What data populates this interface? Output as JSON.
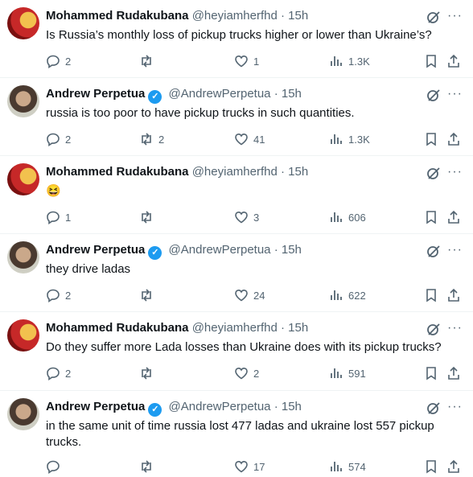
{
  "tweets": [
    {
      "author": "Mohammed Rudakubana",
      "handle": "@heyiamherfhd",
      "dot": "·",
      "time": "15h",
      "verified": false,
      "text": "Is Russia’s monthly loss of pickup trucks higher or lower than Ukraine’s?",
      "replies": "2",
      "retweets": "",
      "likes": "1",
      "views": "1.3K"
    },
    {
      "author": "Andrew Perpetua",
      "handle": "@AndrewPerpetua",
      "dot": "·",
      "time": "15h",
      "verified": true,
      "text": "russia is too poor to have pickup trucks in such quantities.",
      "replies": "2",
      "retweets": "2",
      "likes": "41",
      "views": "1.3K"
    },
    {
      "author": "Mohammed Rudakubana",
      "handle": "@heyiamherfhd",
      "dot": "·",
      "time": "15h",
      "verified": false,
      "text": "😆",
      "replies": "1",
      "retweets": "",
      "likes": "3",
      "views": "606"
    },
    {
      "author": "Andrew Perpetua",
      "handle": "@AndrewPerpetua",
      "dot": "·",
      "time": "15h",
      "verified": true,
      "text": "they drive ladas",
      "replies": "2",
      "retweets": "",
      "likes": "24",
      "views": "622"
    },
    {
      "author": "Mohammed Rudakubana",
      "handle": "@heyiamherfhd",
      "dot": "·",
      "time": "15h",
      "verified": false,
      "text": "Do they suffer more Lada losses than Ukraine does with its pickup trucks?",
      "replies": "2",
      "retweets": "",
      "likes": "2",
      "views": "591"
    },
    {
      "author": "Andrew Perpetua",
      "handle": "@AndrewPerpetua",
      "dot": "·",
      "time": "15h",
      "verified": true,
      "text": "in the same unit of time russia lost 477 ladas and ukraine lost 557 pickup trucks.",
      "replies": "",
      "retweets": "",
      "likes": "17",
      "views": "574"
    }
  ],
  "icons": {
    "verified": "verified-badge-icon",
    "reply": "reply-icon",
    "retweet": "retweet-icon",
    "like": "heart-icon",
    "views": "views-icon",
    "bookmark": "bookmark-icon",
    "share": "share-icon",
    "grok": "grok-icon",
    "more": "more-icon"
  },
  "colors": {
    "text": "#0f1419",
    "secondary": "#536471",
    "verified": "#1d9bf0",
    "divider": "#eff3f4"
  }
}
